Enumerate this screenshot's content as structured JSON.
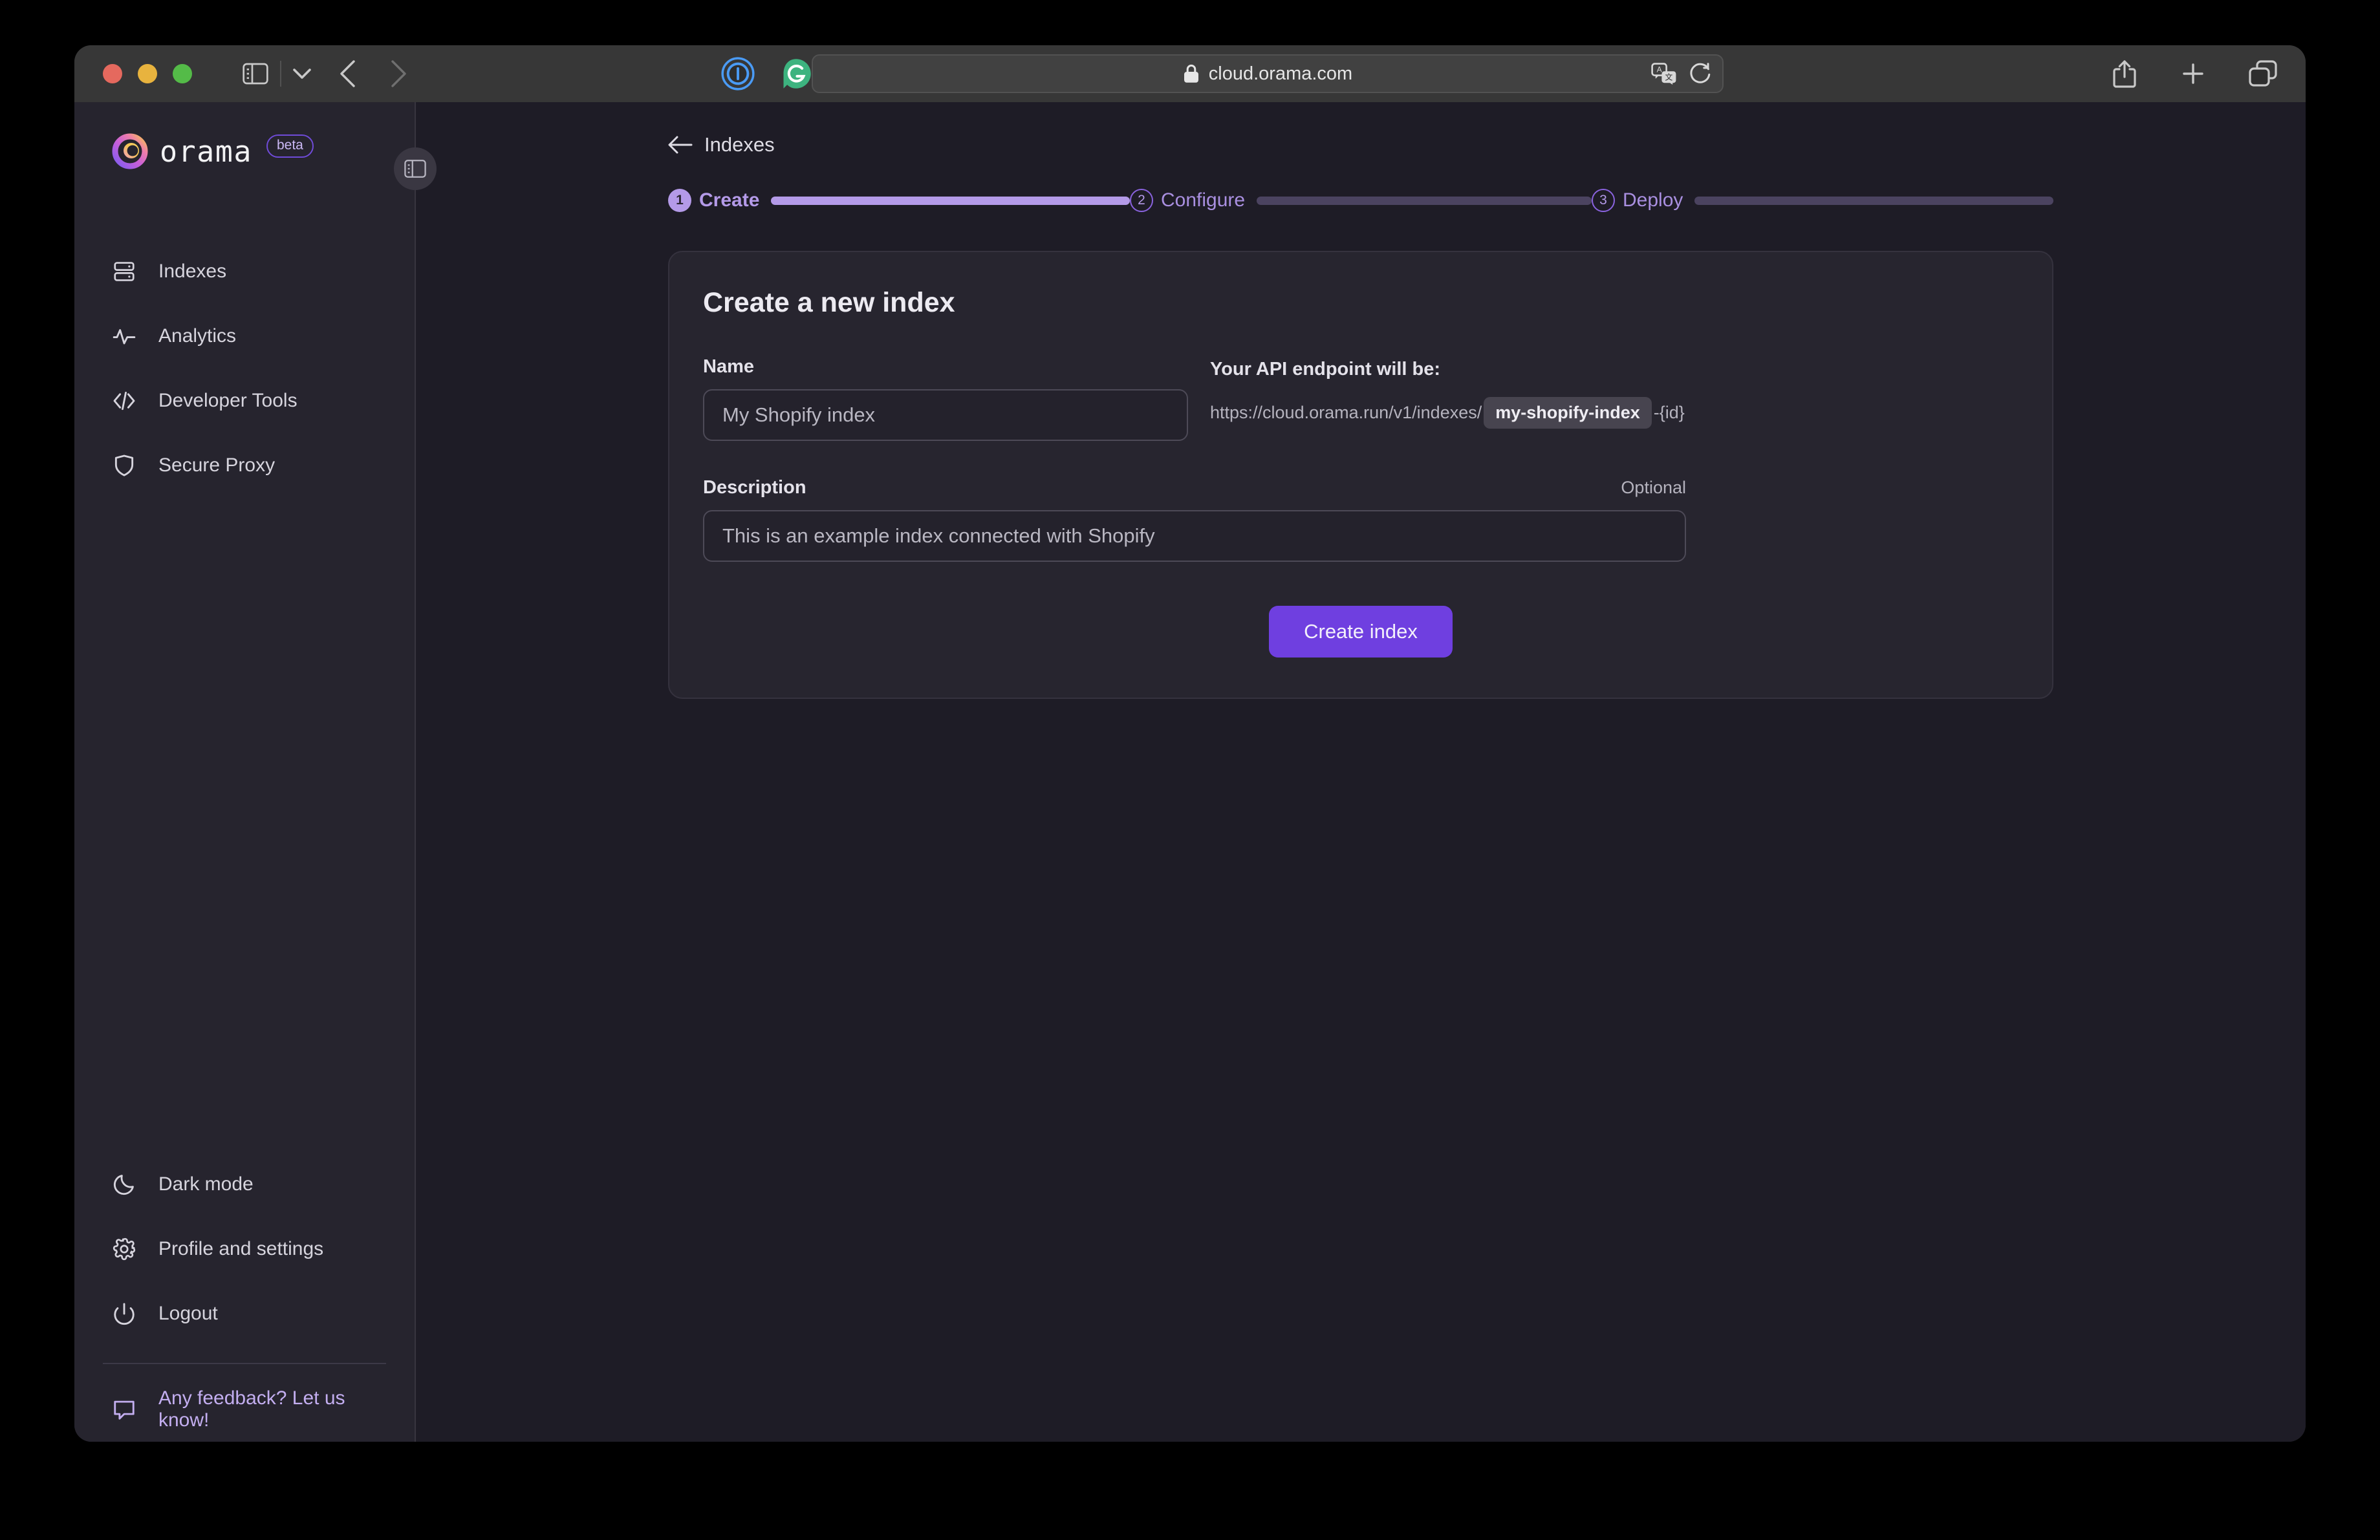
{
  "browser": {
    "url": "cloud.orama.com",
    "lock_icon": "lock-icon",
    "traffic_lights": [
      "close-button",
      "minimize-button",
      "maximize-button"
    ],
    "toolbar_icons": [
      "sidebar-toggle-icon",
      "chevron-down-icon",
      "back-arrow-icon",
      "forward-arrow-icon"
    ],
    "extensions": [
      "1password-extension-icon",
      "grammarly-extension-icon"
    ],
    "address_right_icons": [
      "translate-icon",
      "reload-icon"
    ],
    "right_icons": [
      "share-icon",
      "new-tab-icon",
      "tab-overview-icon"
    ]
  },
  "sidebar": {
    "brand": "orama",
    "badge": "beta",
    "collapse_icon": "sidebar-collapse-icon",
    "primary_items": [
      {
        "label": "Indexes",
        "icon": "database-icon"
      },
      {
        "label": "Analytics",
        "icon": "activity-icon"
      },
      {
        "label": "Developer Tools",
        "icon": "code-icon"
      },
      {
        "label": "Secure Proxy",
        "icon": "shield-icon"
      }
    ],
    "bottom_items": [
      {
        "label": "Dark mode",
        "icon": "moon-icon"
      },
      {
        "label": "Profile and settings",
        "icon": "gear-icon"
      },
      {
        "label": "Logout",
        "icon": "power-icon"
      }
    ],
    "feedback": {
      "label": "Any feedback? Let us know!",
      "icon": "message-icon"
    }
  },
  "main": {
    "breadcrumb": {
      "label": "Indexes",
      "icon": "arrow-left-icon"
    },
    "stepper": [
      {
        "number": "1",
        "label": "Create",
        "state": "active"
      },
      {
        "number": "2",
        "label": "Configure",
        "state": "inactive"
      },
      {
        "number": "3",
        "label": "Deploy",
        "state": "inactive"
      }
    ],
    "card": {
      "title": "Create a new index",
      "name_label": "Name",
      "name_placeholder": "My Shopify index",
      "name_value": "",
      "endpoint_title": "Your API endpoint will be:",
      "endpoint_prefix": "https://cloud.orama.run/v1/indexes/",
      "endpoint_chip": "my-shopify-index",
      "endpoint_suffix": "-{id}",
      "description_label": "Description",
      "description_optional": "Optional",
      "description_placeholder": "This is an example index connected with Shopify",
      "description_value": "",
      "submit_label": "Create index"
    }
  },
  "colors": {
    "accent": "#6f3fe0",
    "accent_light": "#b49ae8",
    "page_bg": "#1e1c26",
    "sidebar_bg": "#26242e",
    "card_bg": "#27252f"
  }
}
